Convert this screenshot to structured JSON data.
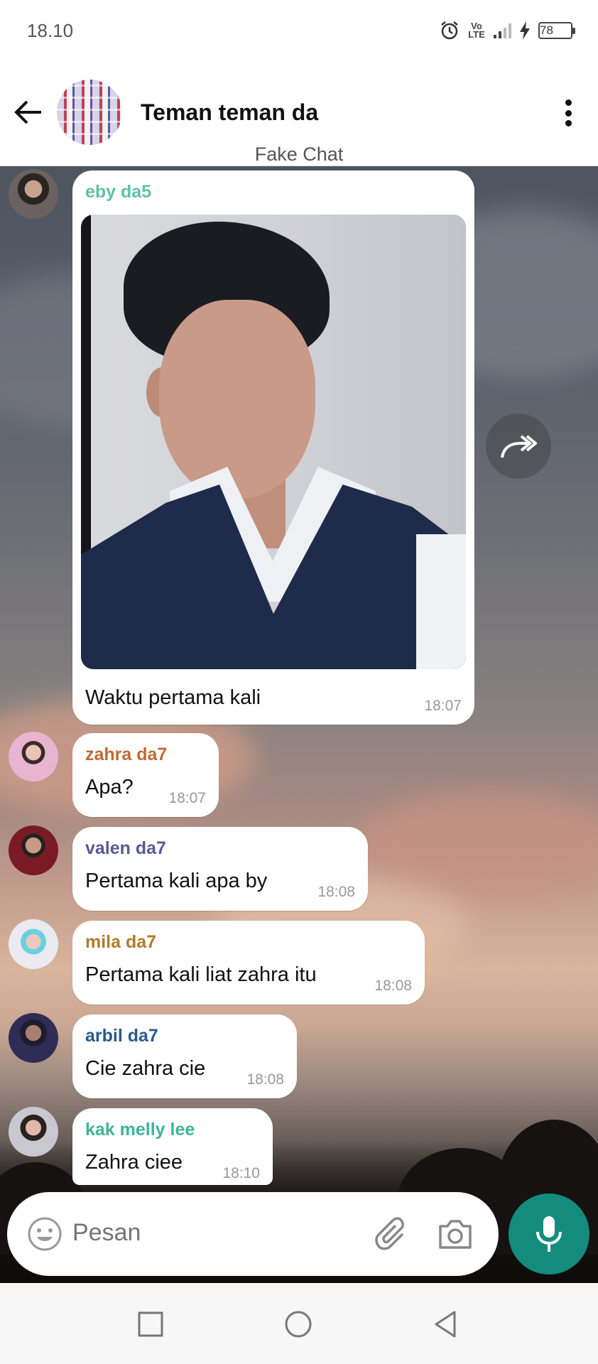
{
  "status_bar": {
    "time": "18.10",
    "network": "Vo LTE",
    "battery": "78"
  },
  "header": {
    "title": "Teman teman da",
    "subtitle": "Fake Chat"
  },
  "messages": [
    {
      "sender": "eby da5",
      "sender_color": "#5ec3a3",
      "text": "Waktu pertama kali",
      "time": "18:07",
      "has_photo": true
    },
    {
      "sender": "zahra da7",
      "sender_color": "#c06a35",
      "text": "Apa?",
      "time": "18:07"
    },
    {
      "sender": "valen da7",
      "sender_color": "#5a5a92",
      "text": "Pertama kali apa by",
      "time": "18:08"
    },
    {
      "sender": "mila da7",
      "sender_color": "#b07c2a",
      "text": "Pertama kali liat zahra itu",
      "time": "18:08"
    },
    {
      "sender": "arbil da7",
      "sender_color": "#2a5a8a",
      "text": "Cie zahra cie",
      "time": "18:08"
    },
    {
      "sender": "kak melly lee",
      "sender_color": "#3fb49a",
      "text": "Zahra ciee",
      "time": "18:10"
    }
  ],
  "input": {
    "placeholder": "Pesan"
  },
  "colors": {
    "accent": "#138c7e",
    "bubble": "#ffffff"
  },
  "icons": [
    "back-arrow-icon",
    "more-vert-icon",
    "forward-icon",
    "emoji-icon",
    "attach-icon",
    "camera-icon",
    "mic-icon",
    "recents-icon",
    "home-icon",
    "back-icon",
    "alarm-icon",
    "signal-icon",
    "charging-icon",
    "battery-icon"
  ]
}
